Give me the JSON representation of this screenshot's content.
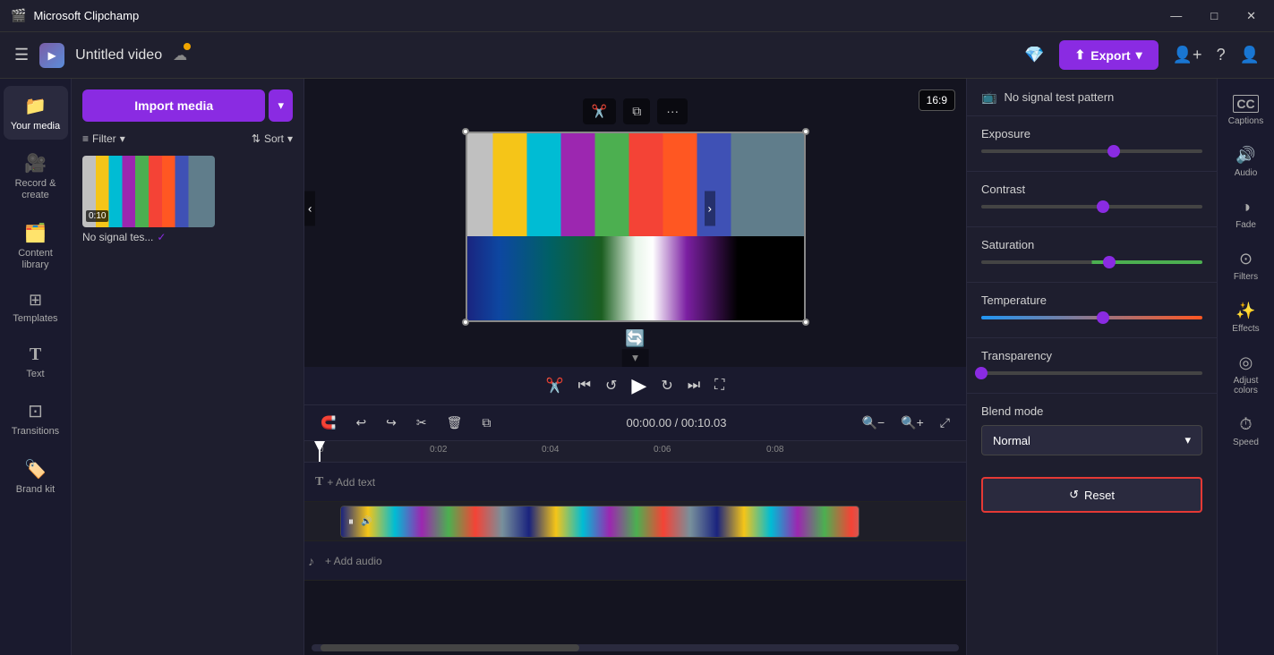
{
  "titlebar": {
    "app_name": "Microsoft Clipchamp",
    "minimize": "—",
    "maximize": "□",
    "close": "✕"
  },
  "topbar": {
    "title": "Untitled video",
    "export_label": "Export",
    "menu_label": "☰"
  },
  "sidebar": {
    "items": [
      {
        "id": "your-media",
        "icon": "📁",
        "label": "Your media"
      },
      {
        "id": "record-create",
        "icon": "🎥",
        "label": "Record & create"
      },
      {
        "id": "content-library",
        "icon": "🗂️",
        "label": "Content library"
      },
      {
        "id": "templates",
        "icon": "⊞",
        "label": "Templates"
      },
      {
        "id": "text",
        "icon": "T",
        "label": "Text"
      },
      {
        "id": "transitions",
        "icon": "⊡",
        "label": "Transitions"
      },
      {
        "id": "brand-kit",
        "icon": "🏷️",
        "label": "Brand kit"
      }
    ]
  },
  "media_panel": {
    "import_btn": "Import media",
    "filter_label": "Filter",
    "sort_label": "Sort",
    "media_item": {
      "name": "No signal tes...",
      "duration": "0:10"
    }
  },
  "preview": {
    "aspect_ratio": "16:9",
    "time_current": "00:00.00",
    "time_total": "00:10.03"
  },
  "right_panel": {
    "header_title": "No signal test pattern",
    "sections": [
      {
        "id": "exposure",
        "label": "Exposure",
        "value": 60
      },
      {
        "id": "contrast",
        "label": "Contrast",
        "value": 55
      },
      {
        "id": "saturation",
        "label": "Saturation",
        "value": 58
      },
      {
        "id": "temperature",
        "label": "Temperature",
        "value": 55
      },
      {
        "id": "transparency",
        "label": "Transparency",
        "value": 0
      }
    ],
    "blend_mode_label": "Blend mode",
    "blend_mode_value": "Normal",
    "reset_label": "Reset"
  },
  "far_right": {
    "items": [
      {
        "id": "captions",
        "icon": "CC",
        "label": "Captions"
      },
      {
        "id": "audio",
        "icon": "🔊",
        "label": "Audio"
      },
      {
        "id": "fade",
        "icon": "◑",
        "label": "Fade"
      },
      {
        "id": "filters",
        "icon": "⊙",
        "label": "Filters"
      },
      {
        "id": "effects",
        "icon": "✨",
        "label": "Effects"
      },
      {
        "id": "adjust-colors",
        "icon": "◎",
        "label": "Adjust colors"
      },
      {
        "id": "speed",
        "icon": "⏱",
        "label": "Speed"
      }
    ]
  },
  "timeline": {
    "time_display": "00:00.00 / 00:10.03",
    "add_text": "+ Add text",
    "add_audio": "+ Add audio",
    "rulers": [
      "0",
      "0:02",
      "0:04",
      "0:06",
      "0:08"
    ]
  }
}
